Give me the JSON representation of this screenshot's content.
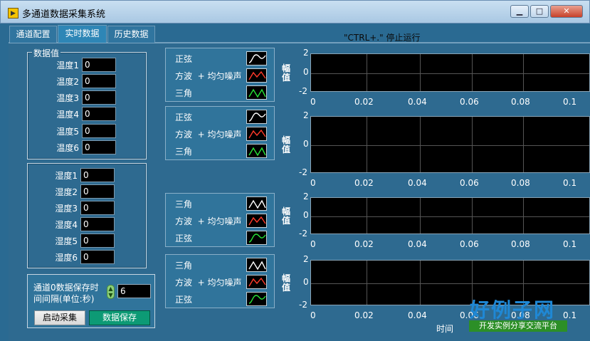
{
  "window": {
    "title": "多通道数据采集系统",
    "controls": {
      "minimize": "▁",
      "maximize": "□",
      "close": "✕"
    }
  },
  "tabs": [
    "通道配置",
    "实时数据",
    "历史数据"
  ],
  "run_hint": "\"CTRL+.\" 停止运行",
  "temperature": {
    "group_title": "数据值",
    "labels": [
      "温度1",
      "温度2",
      "温度3",
      "温度4",
      "温度5",
      "温度6"
    ],
    "values": [
      "0",
      "0",
      "0",
      "0",
      "0",
      "0"
    ]
  },
  "humidity": {
    "labels": [
      "湿度1",
      "湿度2",
      "湿度3",
      "湿度4",
      "湿度5",
      "湿度6"
    ],
    "values": [
      "0",
      "0",
      "0",
      "0",
      "0",
      "0"
    ]
  },
  "legend_sets": [
    [
      "正弦",
      "方波  + 均匀噪声",
      "三角"
    ],
    [
      "正弦",
      "方波  + 均匀噪声",
      "三角"
    ],
    [
      "三角",
      "方波  + 均匀噪声",
      "正弦"
    ],
    [
      "三角",
      "方波  + 均匀噪声",
      "正弦"
    ]
  ],
  "legend_colors": [
    "#ffffff",
    "#ff3a2a",
    "#27e437"
  ],
  "charts": {
    "ylabel": "幅值",
    "xlabel": "时间",
    "y_ticks": [
      "2",
      "0",
      "-2"
    ],
    "x_ticks": [
      "0",
      "0.02",
      "0.04",
      "0.06",
      "0.08",
      "0.1"
    ]
  },
  "save": {
    "label": "通道0数据保存时间间隔(单位:秒)",
    "value": "6",
    "start_button": "启动采集",
    "save_button": "数据保存"
  },
  "watermark": {
    "title": "好例子网",
    "subtitle": "开发实例分享交流平台"
  }
}
